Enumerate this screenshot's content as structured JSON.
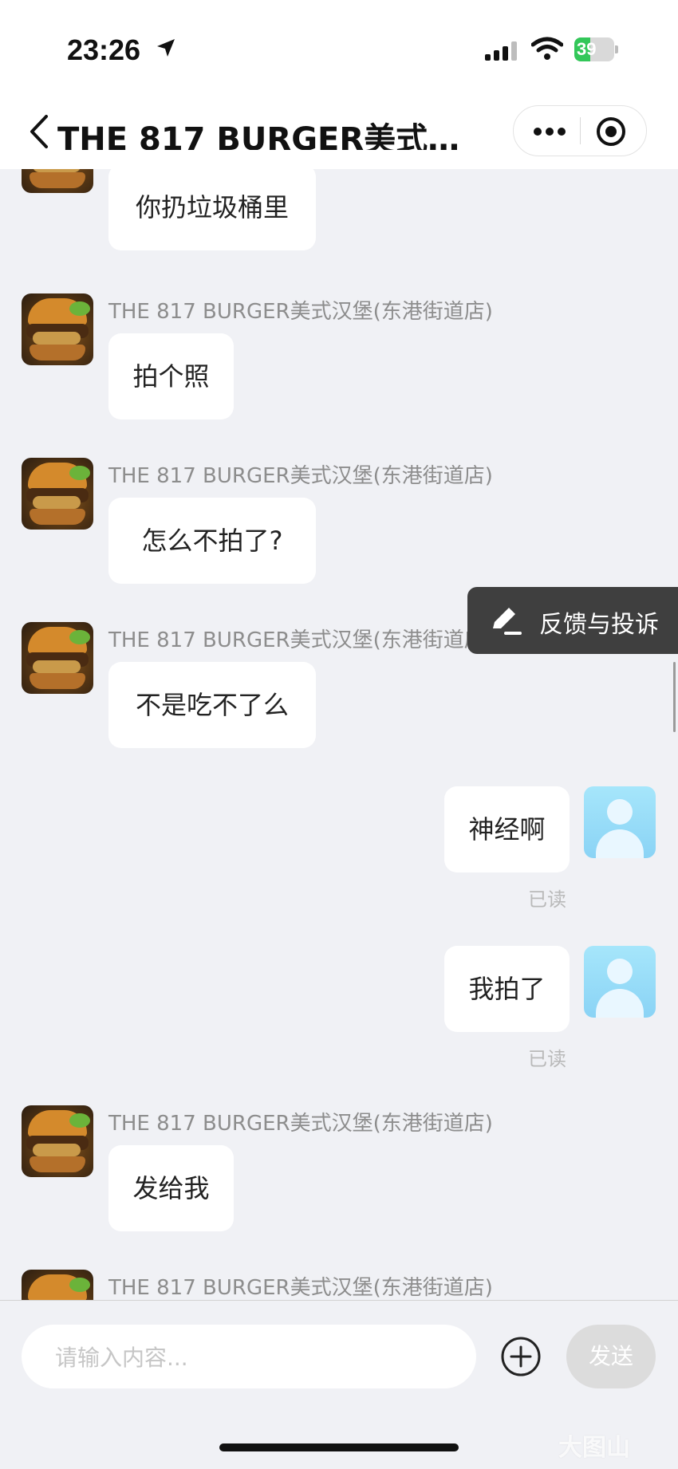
{
  "status_bar": {
    "time": "23:26",
    "battery": "39",
    "battery_level": 0.39
  },
  "nav": {
    "title": "THE 817 BURGER美式汉...",
    "more_icon": "more-icon",
    "close_icon": "target-icon"
  },
  "shop_name": "THE 817 BURGER美式汉堡(东港街道店)",
  "messages": [
    {
      "from": "shop",
      "text": "你扔垃圾桶里"
    },
    {
      "from": "shop",
      "text": "拍个照"
    },
    {
      "from": "shop",
      "text": "怎么不拍了?"
    },
    {
      "from": "shop",
      "text": "不是吃不了么"
    },
    {
      "from": "me",
      "text": "神经啊",
      "status": "已读"
    },
    {
      "from": "me",
      "text": "我拍了",
      "status": "已读"
    },
    {
      "from": "shop",
      "text": "发给我"
    }
  ],
  "feedback": {
    "label": "反馈与投诉"
  },
  "input": {
    "placeholder": "请输入内容...",
    "send_label": "发送"
  },
  "watermark": "大图山",
  "colors": {
    "bubble": "#ffffff",
    "background": "#f0f1f5",
    "feedback_bg": "#3f3f3f",
    "battery": "#33c759"
  }
}
